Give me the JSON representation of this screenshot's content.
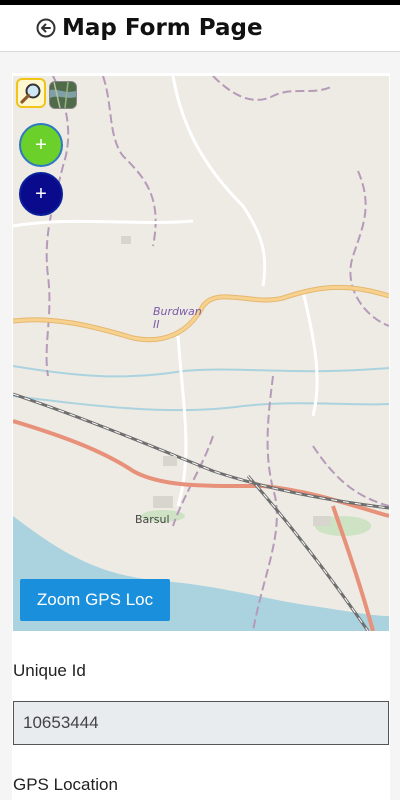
{
  "header": {
    "title": "Map Form Page",
    "back_icon": "circle-arrow-left-icon"
  },
  "map": {
    "place_labels": {
      "burdwan": "Burdwan\nII",
      "barsul": "Barsul"
    },
    "tools": {
      "search_icon": "magnifier-icon",
      "satellite_icon": "satellite-layer-icon"
    },
    "buttons": {
      "add_green": "+",
      "add_navy": "+",
      "zoom_gps": "Zoom GPS Loc"
    },
    "colors": {
      "green": "#6bd12a",
      "navy": "#0a0a8c",
      "zoom": "#1a8fdc"
    }
  },
  "form": {
    "unique_id": {
      "label": "Unique Id",
      "value": "10653444"
    },
    "gps_location": {
      "label": "GPS Location"
    }
  }
}
